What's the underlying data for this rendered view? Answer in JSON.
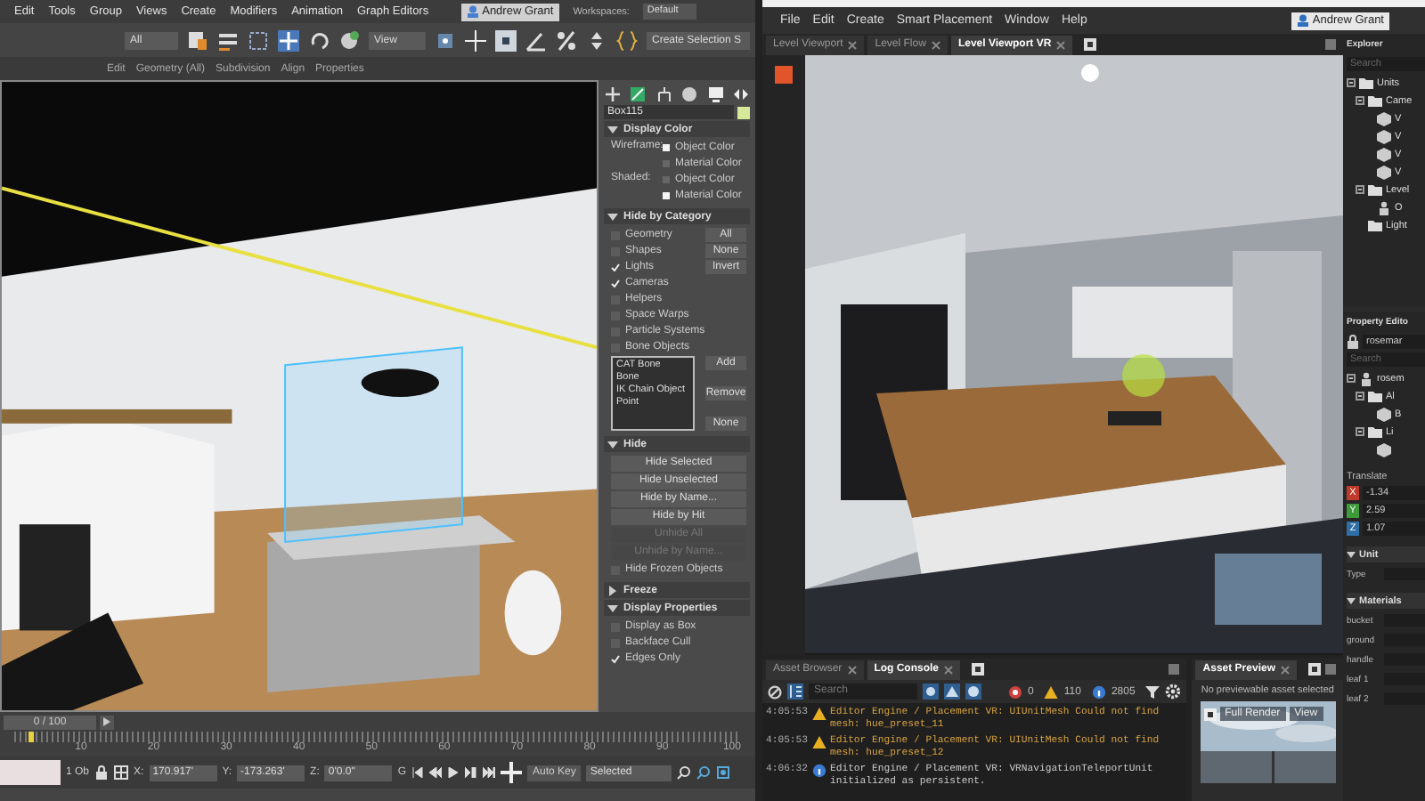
{
  "max": {
    "menu": [
      "Edit",
      "Tools",
      "Group",
      "Views",
      "Create",
      "Modifiers",
      "Animation",
      "Graph Editors"
    ],
    "user": "Andrew Grant",
    "workspace": {
      "label": "Workspaces:",
      "value": "Default"
    },
    "toolbar": {
      "filter": "All",
      "view": "View",
      "selection_set": "Create Selection S"
    },
    "ribbon": [
      "Edit",
      "Geometry (All)",
      "Subdivision",
      "Align",
      "Properties"
    ],
    "viewport": {
      "kind": "picture"
    },
    "command_panel": {
      "object_name": "Box115",
      "sections": [
        {
          "title": "Display Color",
          "expanded": true,
          "rows": [
            {
              "kind": "radio",
              "label": "Wireframe:",
              "options": [
                {
                  "label": "Object Color",
                  "selected": true
                },
                {
                  "label": "Material Color",
                  "selected": false
                }
              ]
            },
            {
              "kind": "radio",
              "label": "Shaded:",
              "options": [
                {
                  "label": "Object Color",
                  "selected": false
                },
                {
                  "label": "Material Color",
                  "selected": true
                }
              ]
            }
          ]
        },
        {
          "title": "Hide by Category",
          "expanded": true,
          "rows": [
            {
              "kind": "check",
              "label": "Geometry",
              "checked": false,
              "button": "All"
            },
            {
              "kind": "check",
              "label": "Shapes",
              "checked": false,
              "button": "None"
            },
            {
              "kind": "check",
              "label": "Lights",
              "checked": true,
              "button": "Invert"
            },
            {
              "kind": "check",
              "label": "Cameras",
              "checked": true
            },
            {
              "kind": "check",
              "label": "Helpers",
              "checked": false
            },
            {
              "kind": "check",
              "label": "Space Warps",
              "checked": false
            },
            {
              "kind": "check",
              "label": "Particle Systems",
              "checked": false
            },
            {
              "kind": "check",
              "label": "Bone Objects",
              "checked": false
            },
            {
              "kind": "list",
              "items": [
                "CAT Bone",
                "Bone",
                "IK Chain Object",
                "Point"
              ],
              "buttons": [
                "Add",
                "Remove",
                "None"
              ]
            }
          ]
        },
        {
          "title": "Hide",
          "expanded": true,
          "rows": [
            {
              "kind": "button",
              "label": "Hide Selected",
              "disabled": false
            },
            {
              "kind": "button",
              "label": "Hide Unselected",
              "disabled": false
            },
            {
              "kind": "button",
              "label": "Hide by Name...",
              "disabled": false
            },
            {
              "kind": "button",
              "label": "Hide by Hit",
              "disabled": false
            },
            {
              "kind": "button",
              "label": "Unhide All",
              "disabled": true
            },
            {
              "kind": "button",
              "label": "Unhide by Name...",
              "disabled": true
            },
            {
              "kind": "check",
              "label": "Hide Frozen Objects",
              "checked": false
            }
          ]
        },
        {
          "title": "Freeze",
          "expanded": false
        },
        {
          "title": "Display Properties",
          "expanded": true,
          "rows": [
            {
              "kind": "check",
              "label": "Display as Box",
              "checked": false
            },
            {
              "kind": "check",
              "label": "Backface Cull",
              "checked": false
            },
            {
              "kind": "check",
              "label": "Edges Only",
              "checked": true
            }
          ]
        }
      ]
    },
    "timeline": {
      "frame": "0 / 100",
      "ticks": [
        "10",
        "20",
        "30",
        "40",
        "50",
        "60",
        "70",
        "80",
        "90",
        "100"
      ]
    },
    "status": {
      "selection": "1 Ob",
      "coords": [
        {
          "label": "X:",
          "value": "170.917'"
        },
        {
          "label": "Y:",
          "value": "-173.263'"
        },
        {
          "label": "Z:",
          "value": "0'0.0\""
        }
      ],
      "grid": "G",
      "auto_key": "Auto Key",
      "key_filter": "Selected"
    }
  },
  "editor": {
    "menu": [
      "File",
      "Edit",
      "Create",
      "Smart Placement",
      "Window",
      "Help"
    ],
    "user": "Andrew Grant",
    "tabs": [
      {
        "label": "Level Viewport",
        "selected": false
      },
      {
        "label": "Level Flow",
        "selected": false
      },
      {
        "label": "Level Viewport VR",
        "selected": true
      }
    ],
    "viewport": {
      "kind": "picture"
    },
    "explorer": {
      "title": "Explorer",
      "search": {
        "placeholder": "Search"
      },
      "tree": [
        {
          "label": "Units",
          "kind": "folder",
          "children": [
            {
              "label": "Came",
              "kind": "folder",
              "children": [
                {
                  "label": "V",
                  "kind": "mesh"
                },
                {
                  "label": "V",
                  "kind": "mesh"
                },
                {
                  "label": "V",
                  "kind": "mesh"
                },
                {
                  "label": "V",
                  "kind": "mesh"
                }
              ]
            },
            {
              "label": "Level",
              "kind": "folder",
              "children": [
                {
                  "label": "O",
                  "kind": "actor"
                }
              ]
            },
            {
              "label": "Light",
              "kind": "folder"
            }
          ]
        }
      ]
    },
    "property_editor": {
      "title": "Property Edito",
      "object": "rosemar",
      "search": {
        "placeholder": "Search"
      },
      "tree": [
        {
          "label": "rosem",
          "kind": "actor",
          "children": [
            {
              "label": "Al",
              "kind": "folder",
              "children": [
                {
                  "label": "B",
                  "kind": "mesh"
                }
              ]
            },
            {
              "label": "Li",
              "kind": "folder",
              "children": [
                {
                  "kind": "mesh"
                }
              ]
            }
          ]
        }
      ],
      "translate": {
        "title": "Translate",
        "axes": [
          {
            "axis": "X",
            "value": "-1.34",
            "color": "#c0392b"
          },
          {
            "axis": "Y",
            "value": "2.59",
            "color": "#3f9a3a"
          },
          {
            "axis": "Z",
            "value": "1.07",
            "color": "#2f6fa8"
          }
        ]
      },
      "unit": {
        "title": "Unit",
        "field": "Type"
      },
      "materials": {
        "title": "Materials",
        "items": [
          "bucket",
          "ground",
          "handle",
          "leaf 1",
          "leaf 2"
        ]
      }
    },
    "console": {
      "tabs": [
        {
          "label": "Asset Browser",
          "selected": false
        },
        {
          "label": "Log Console",
          "selected": true
        }
      ],
      "search": {
        "placeholder": "Search"
      },
      "counts": [
        {
          "kind": "error",
          "value": "0"
        },
        {
          "kind": "warning",
          "value": "110"
        },
        {
          "kind": "info",
          "value": "2805"
        }
      ],
      "rows": [
        {
          "time": "4:05:53",
          "kind": "warning",
          "message": "Editor Engine / Placement VR: UIUnitMesh Could not find mesh: hue_preset_11"
        },
        {
          "time": "4:05:53",
          "kind": "warning",
          "message": "Editor Engine / Placement VR: UIUnitMesh Could not find mesh: hue_preset_12"
        },
        {
          "time": "4:06:32",
          "kind": "info",
          "message": "Editor Engine / Placement VR: VRNavigationTeleportUnit initialized as persistent."
        }
      ]
    },
    "asset_preview": {
      "tab": "Asset Preview",
      "message": "No previewable asset selected",
      "buttons": [
        "Full Render",
        "View"
      ],
      "thumbnail": {
        "kind": "picture"
      }
    }
  }
}
